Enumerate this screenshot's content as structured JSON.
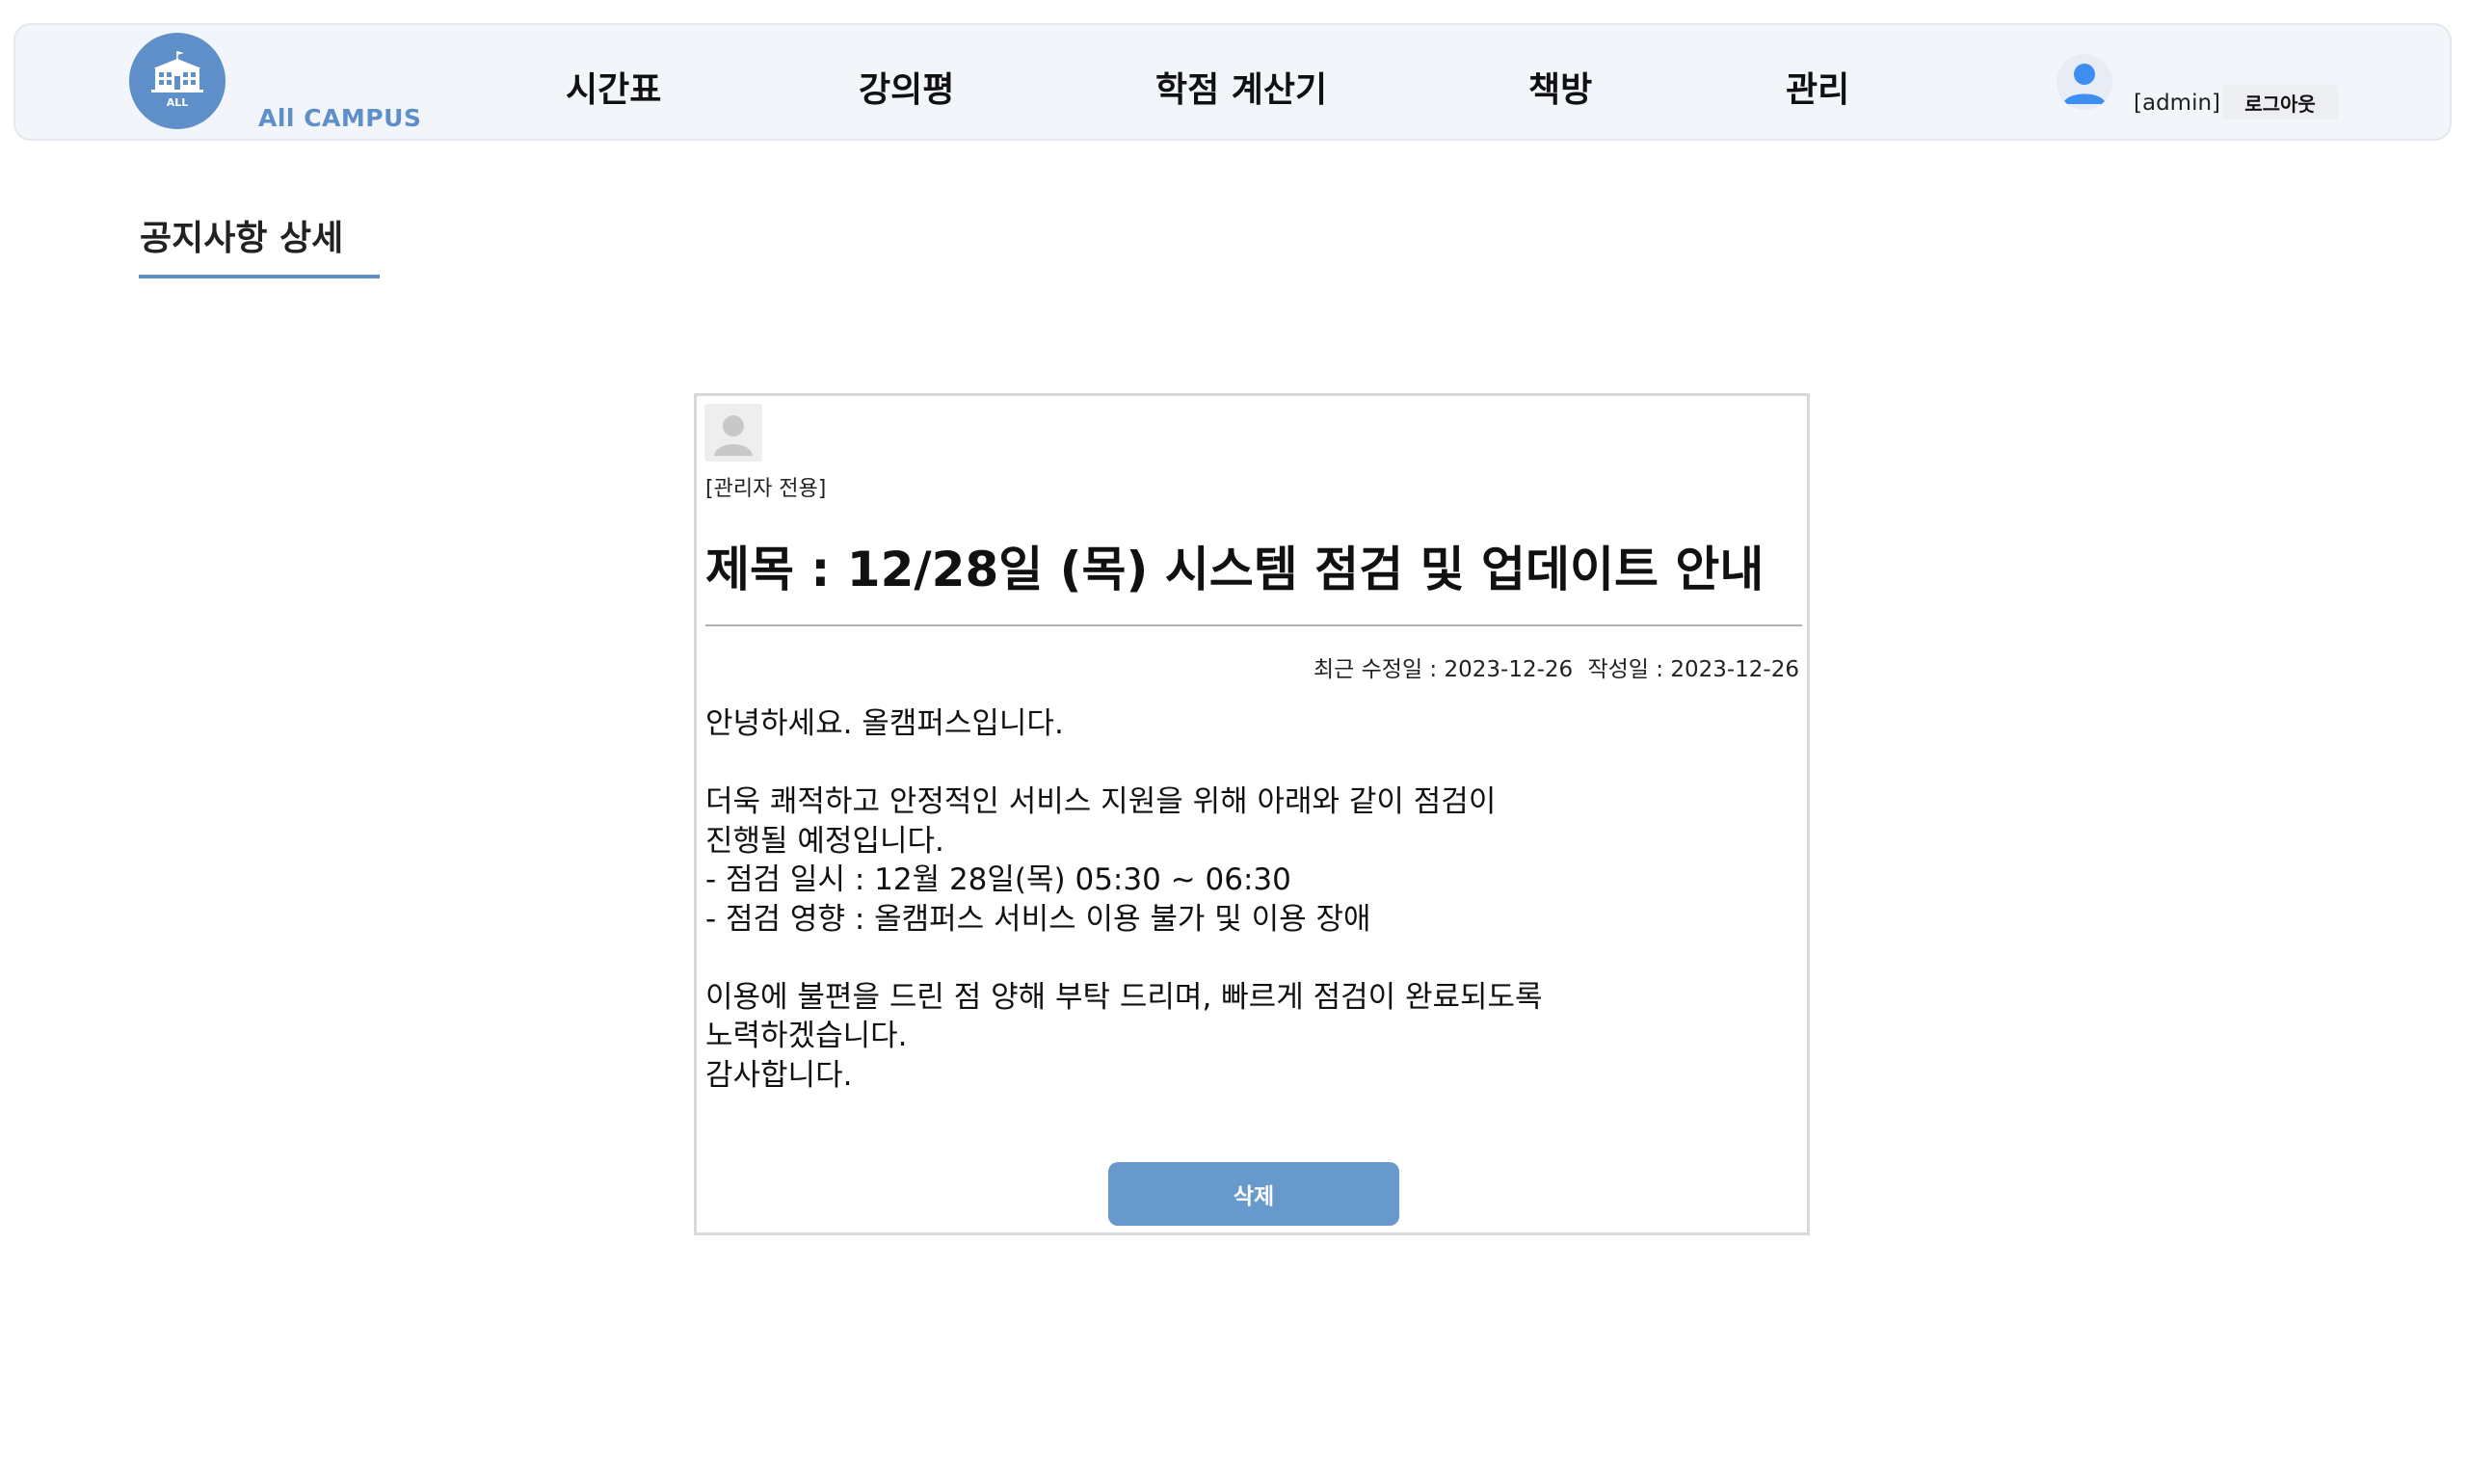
{
  "header": {
    "brand": "All CAMPUS",
    "logo_text": "ALL",
    "nav": [
      {
        "label": "시간표"
      },
      {
        "label": "강의평"
      },
      {
        "label": "학점 계산기"
      },
      {
        "label": "책방"
      },
      {
        "label": "관리"
      }
    ],
    "user_label": "[admin]",
    "logout_label": "로그아웃"
  },
  "page_title": "공지사항 상세",
  "notice": {
    "author_label": "[관리자 전용]",
    "title": "제목 : 12/28일 (목) 시스템 점검 및 업데이트 안내",
    "modified_label": "최근 수정일 : 2023-12-26",
    "created_label": "작성일 : 2023-12-26",
    "content": "안녕하세요. 올캠퍼스입니다.\n\n더욱 쾌적하고 안정적인 서비스 지원을 위해 아래와 같이 점검이\n진행될 예정입니다.\n- 점검 일시 : 12월 28일(목) 05:30 ~ 06:30\n- 점검 영향 : 올캠퍼스 서비스 이용 불가 및 이용 장애\n\n이용에 불편을 드린 점 양해 부탁 드리며, 빠르게 점검이 완료되도록\n노력하겠습니다.\n감사합니다.",
    "delete_label": "삭제"
  },
  "colors": {
    "accent": "#5e8fc9",
    "header_bg": "#f2f5fa",
    "delete_button": "#6899cc"
  },
  "icons": {
    "logo": "school-building-icon",
    "user": "user-avatar-icon",
    "author": "default-profile-icon"
  }
}
